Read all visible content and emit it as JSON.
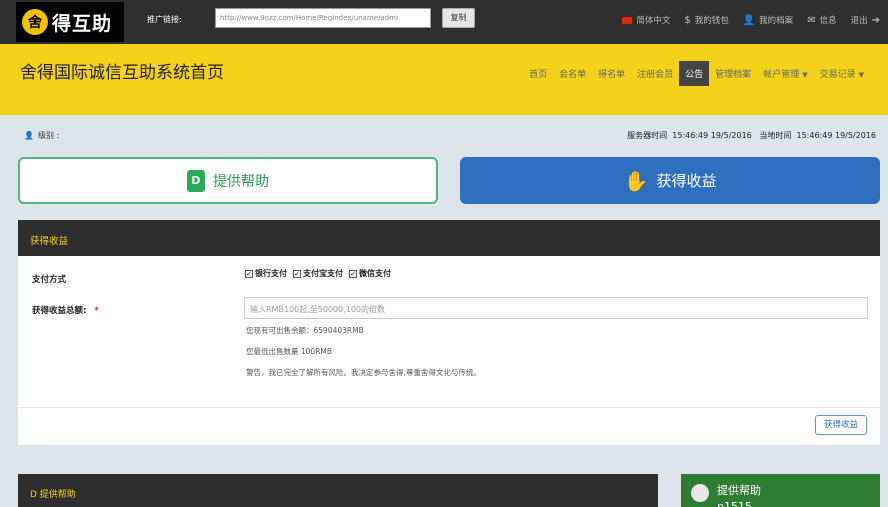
{
  "topbar": {
    "logo_text": "得互助",
    "logo_badge": "舍",
    "promo_label": "推广链接:",
    "promo_url": "http://www.9ozz.com/Home/RegIndex/uname/admi",
    "copy_label": "复制",
    "nav": [
      {
        "label": "简体中文",
        "icon": "china-flag-icon"
      },
      {
        "label": "我的钱包",
        "icon": "dollar-icon",
        "glyph": "$"
      },
      {
        "label": "我的档案",
        "icon": "user-icon",
        "glyph": "👤"
      },
      {
        "label": "信息",
        "icon": "message-icon",
        "glyph": "✉"
      },
      {
        "label": "退出",
        "icon": "logout-icon",
        "glyph": "➔"
      }
    ]
  },
  "header": {
    "title": "舍得国际诚信互助系统首页",
    "nav": [
      {
        "label": "首页",
        "active": false
      },
      {
        "label": "会名单",
        "active": false
      },
      {
        "label": "得名单",
        "active": false
      },
      {
        "label": "注册会员",
        "active": false
      },
      {
        "label": "公告",
        "active": true
      },
      {
        "label": "管理档案",
        "active": false
      },
      {
        "label": "帐户管理",
        "active": false,
        "dropdown": true
      },
      {
        "label": "交易记录",
        "active": false,
        "dropdown": true
      }
    ]
  },
  "info": {
    "level_label": "级别 :",
    "server_time_label": "服务器时间",
    "server_time": "15:46:49 19/5/2016",
    "local_time_label": "当地时间",
    "local_time": "15:46:49 19/5/2016"
  },
  "actions": {
    "provide_label": "提供帮助",
    "provide_icon_letter": "D",
    "gain_label": "获得收益"
  },
  "panel": {
    "title": "获得收益",
    "payment_label": "支付方式",
    "payment_options": [
      "银行支付",
      "支付宝支付",
      "微信支付"
    ],
    "amount_label": "获得收益总额:",
    "amount_required": "*",
    "amount_placeholder": "输入RMB100起,至50000,100的倍数",
    "available_text": "您现有可出售余额：6590403RMB",
    "min_text": "您最低出售数量 100RMB",
    "warning_text": "警告，我已完全了解所有风险。我决定参与舍得,尊重舍得文化与传统。",
    "submit_label": "获得收益"
  },
  "bottom": {
    "panel_title": "D 提供帮助",
    "card_title": "提供帮助",
    "card_code": "p1515"
  },
  "colors": {
    "brand_yellow": "#f5d21a",
    "topbar": "#2f2f2f",
    "green": "#2b9a5c",
    "blue": "#2f6fbf"
  }
}
